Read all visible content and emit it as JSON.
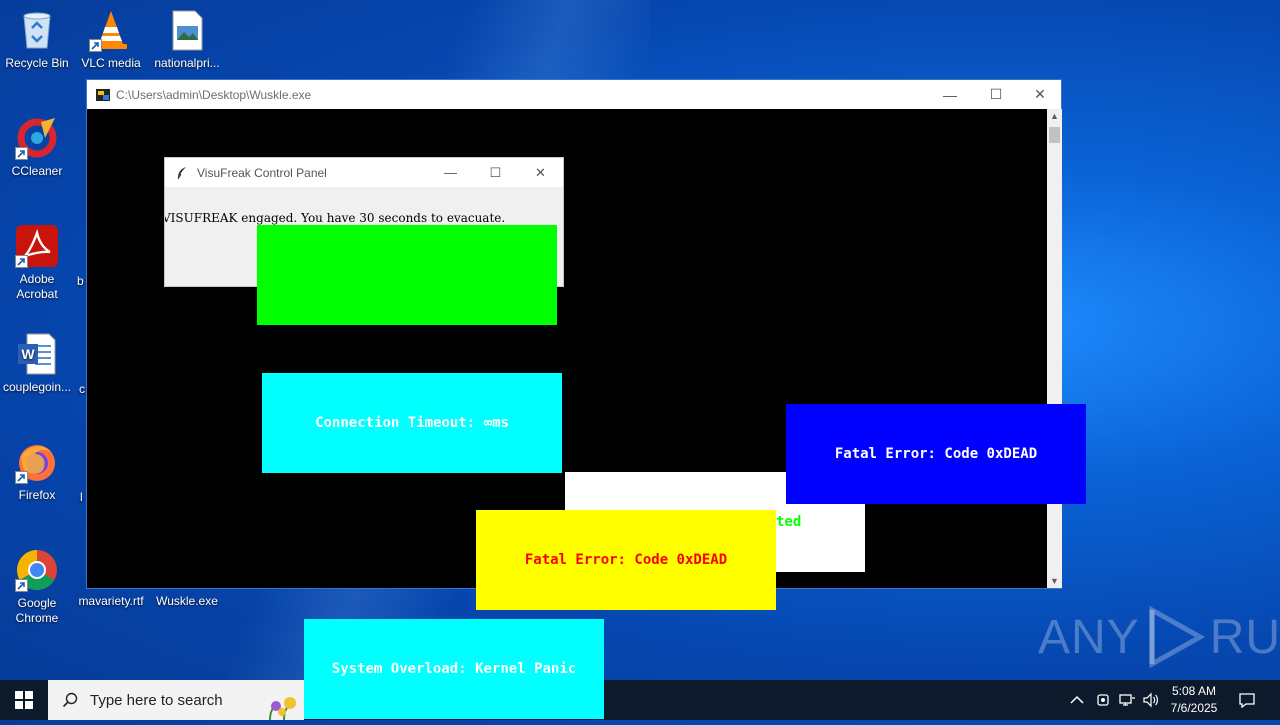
{
  "desktop": {
    "icons": [
      {
        "label": "Recycle Bin"
      },
      {
        "label": "VLC media"
      },
      {
        "label": "nationalpri..."
      },
      {
        "label": "CCleaner"
      },
      {
        "label": "Adobe Acrobat"
      },
      {
        "label": "couplegoin..."
      },
      {
        "label": "Firefox"
      },
      {
        "label": "Google Chrome"
      },
      {
        "label": "mavariety.rtf"
      },
      {
        "label": "Wuskle.exe"
      }
    ],
    "partial_labels": [
      "b",
      "c",
      "l"
    ]
  },
  "console_window": {
    "title": "C:\\Users\\admin\\Desktop\\Wuskle.exe",
    "controls": {
      "minimize": "—",
      "maximize": "☐",
      "close": "✕"
    }
  },
  "control_panel": {
    "title": "VisuFreak Control Panel",
    "message": "VISUFREAK engaged. You have 30 seconds to evacuate.",
    "controls": {
      "minimize": "—",
      "maximize": "☐",
      "close": "✕"
    }
  },
  "popups": [
    {
      "name": "green-box",
      "text": "",
      "bg": "#00ff00",
      "fg": "#000000"
    },
    {
      "name": "connection-timeout",
      "text": "Connection Timeout: ∞ms",
      "bg": "#00ffff",
      "fg": "#ffffff"
    },
    {
      "name": "white-box",
      "text": "ted",
      "bg": "#ffffff",
      "fg": "#00ff00"
    },
    {
      "name": "fatal-blue",
      "text": "Fatal Error: Code 0xDEAD",
      "bg": "#0000ff",
      "fg": "#ffffff"
    },
    {
      "name": "fatal-yellow",
      "text": "Fatal Error: Code 0xDEAD",
      "bg": "#ffff00",
      "fg": "#ff0000"
    },
    {
      "name": "system-overload",
      "text": "System Overload: Kernel Panic",
      "bg": "#00ffff",
      "fg": "#ffffff"
    }
  ],
  "taskbar": {
    "search_placeholder": "Type here to search",
    "time": "5:08 AM",
    "date": "7/6/2025"
  },
  "watermark": {
    "left": "ANY",
    "right": "RUN"
  }
}
